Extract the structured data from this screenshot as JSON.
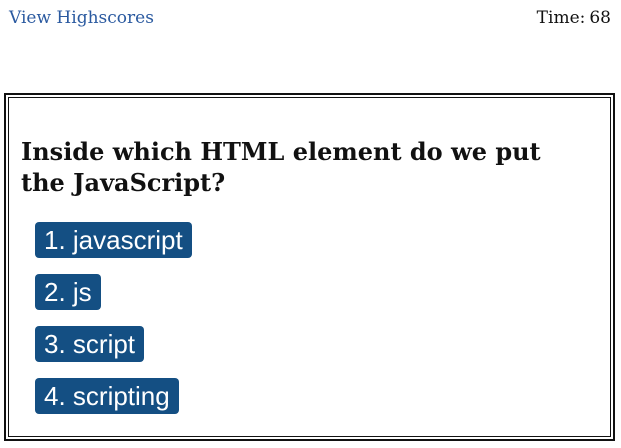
{
  "header": {
    "highscores_link": "View Highscores",
    "timer_label": "Time:",
    "timer_value": "68"
  },
  "quiz": {
    "question": "Inside which HTML element do we put the JavaScript?",
    "choices": [
      "1. javascript",
      "2. js",
      "3. script",
      "4. scripting"
    ]
  },
  "colors": {
    "link": "#2b5aa0",
    "button_bg": "#144f83",
    "button_text": "#ffffff",
    "border": "#111111"
  }
}
